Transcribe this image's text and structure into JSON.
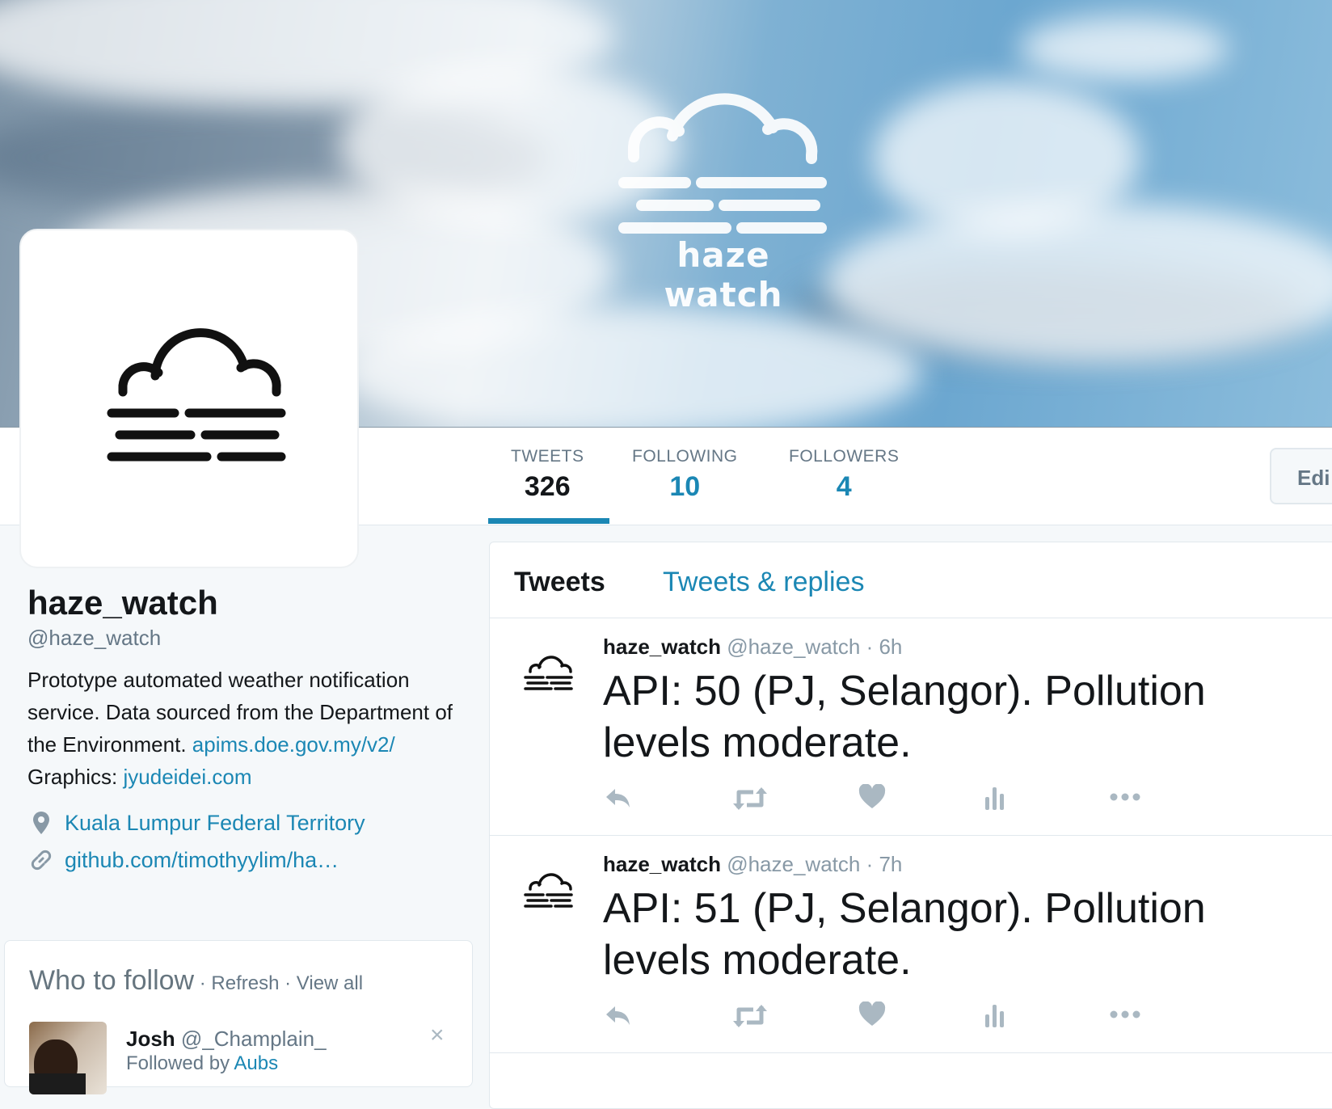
{
  "banner": {
    "logo_text": "haze watch"
  },
  "nav": {
    "stats": [
      {
        "label": "TWEETS",
        "value": "326"
      },
      {
        "label": "FOLLOWING",
        "value": "10"
      },
      {
        "label": "FOLLOWERS",
        "value": "4"
      }
    ],
    "edit_label": "Edi"
  },
  "profile": {
    "name": "haze_watch",
    "handle": "@haze_watch",
    "bio": "Prototype automated weather notification service. Data sourced from the Department of the Environment. ",
    "bio_link": "apims.doe.gov.my/v2/",
    "bio_suffix": " Graphics: ",
    "bio_link2": "jyudeidei.com",
    "location": "Kuala Lumpur Federal Territory",
    "website": "github.com/timothyylim/ha…"
  },
  "who_to_follow": {
    "title": "Who to follow",
    "sep": " · ",
    "refresh": "Refresh",
    "view_all": "View all",
    "person": {
      "name": "Josh",
      "handle": "@_Champlain_",
      "followed_by_prefix": "Followed by ",
      "followed_by_name": "Aubs"
    },
    "close": "×"
  },
  "timeline": {
    "tabs": [
      "Tweets",
      "Tweets & replies"
    ],
    "tweets": [
      {
        "name": "haze_watch",
        "handle": "@haze_watch",
        "time": "· 6h",
        "text": "API: 50 (PJ, Selangor). Pollution levels moderate."
      },
      {
        "name": "haze_watch",
        "handle": "@haze_watch",
        "time": "· 7h",
        "text": "API: 51 (PJ, Selangor). Pollution levels moderate."
      }
    ],
    "action_icons": [
      "reply-icon",
      "retweet-icon",
      "like-icon",
      "analytics-icon",
      "more-icon"
    ]
  },
  "colors": {
    "link": "#1b87b4",
    "text": "#14171a",
    "muted": "#657786",
    "page_bg": "#f5f8fa"
  }
}
